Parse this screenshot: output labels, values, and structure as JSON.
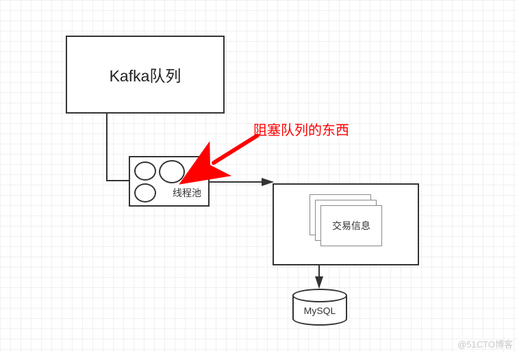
{
  "diagram": {
    "kafka_label": "Kafka队列",
    "threadpool_label": "线程池",
    "transaction_label": "交易信息",
    "database_label": "MySQL",
    "annotation_text": "阻塞队列的东西",
    "watermark": "@51CTO博客",
    "annotation_color": "#ff0000"
  },
  "flow": [
    {
      "from": "kafka-queue",
      "to": "thread-pool"
    },
    {
      "from": "thread-pool",
      "to": "transaction-box"
    },
    {
      "from": "transaction-box",
      "to": "mysql-db"
    }
  ]
}
